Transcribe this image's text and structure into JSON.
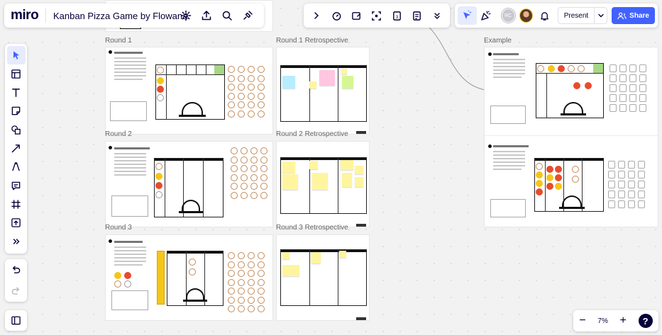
{
  "app": {
    "logo": "miro",
    "board_title": "Kanban Pizza Game by Flowana"
  },
  "top_left_icons": [
    "settings-icon",
    "upload-icon",
    "search-icon",
    "plugin-icon"
  ],
  "top_center_icons": [
    "chevron-right-icon",
    "timer-icon",
    "card-icon",
    "focus-icon",
    "counter-icon",
    "notes-icon",
    "more-icon"
  ],
  "top_right": {
    "cursor_tool": "cursor-reaction-icon",
    "celebrate_tool": "celebrate-icon",
    "collaborator_initials": "RC",
    "notifications": "bell-icon",
    "present_label": "Present",
    "share_label": "Share"
  },
  "left_tools": [
    "select",
    "templates",
    "text",
    "sticky-note",
    "shapes",
    "connection-line",
    "pen",
    "comment",
    "frame",
    "upload",
    "more-tools"
  ],
  "zoom": {
    "value": "7%",
    "minus": "−",
    "plus": "+",
    "help": "?"
  },
  "frames": {
    "round1": "Round 1",
    "round1_retro": "Round 1 Retrospective",
    "round2": "Round 2",
    "round2_retro": "Round 2 Retrospective",
    "round3": "Round 3",
    "round3_retro": "Round 3 Retrospective",
    "example": "Example"
  },
  "colors": {
    "accent": "#4262ff",
    "sticky_blue": "#b8ecff",
    "sticky_pink": "#ffc6e0",
    "sticky_yellow": "#fff59f",
    "sticky_green": "#d5f692",
    "ingredient_yellow": "#f5c518",
    "ingredient_red": "#e74c2c",
    "oven_green": "#a6d785"
  }
}
